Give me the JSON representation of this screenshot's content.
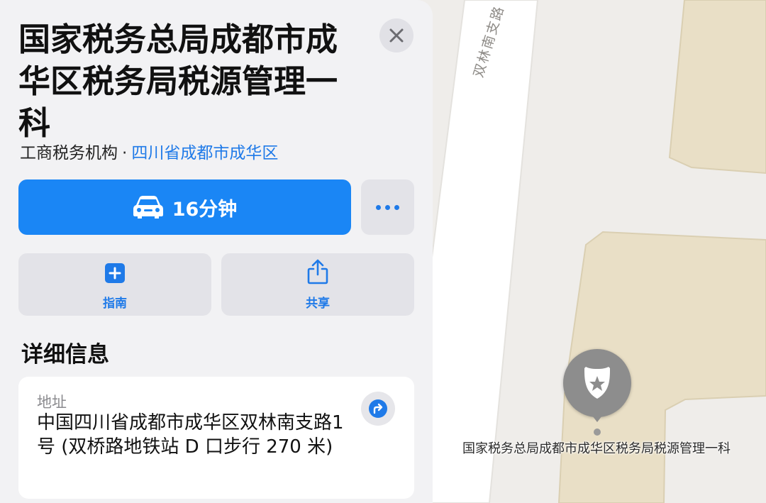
{
  "place": {
    "title": "国家税务总局成都市成华区税务局税源管理一科",
    "category": "工商税务机构",
    "separator": "·",
    "region_link": "四川省成都市成华区"
  },
  "actions": {
    "drive_time": "16分钟",
    "guide_label": "指南",
    "share_label": "共享"
  },
  "details": {
    "section_title": "详细信息",
    "address_label": "地址",
    "address_value": "中国四川省成都市成华区双林南支路1号 (双桥路地铁站 D 口步行 270 米)"
  },
  "map": {
    "road_name": "双林南支路",
    "pin_label": "国家税务总局成都市成华区税务局税源管理一科",
    "pin_icon": "police-badge-star-icon"
  },
  "icons": {
    "close": "close-icon",
    "car": "car-icon",
    "more": "ellipsis-icon",
    "guide": "plus-square-icon",
    "share": "share-icon",
    "directions": "turn-right-arrow-icon"
  },
  "colors": {
    "accent": "#1a86f5",
    "link": "#1f7ae8",
    "sheet_bg": "#f2f2f4",
    "map_bg": "#efedea",
    "building": "#e9dfc6"
  }
}
